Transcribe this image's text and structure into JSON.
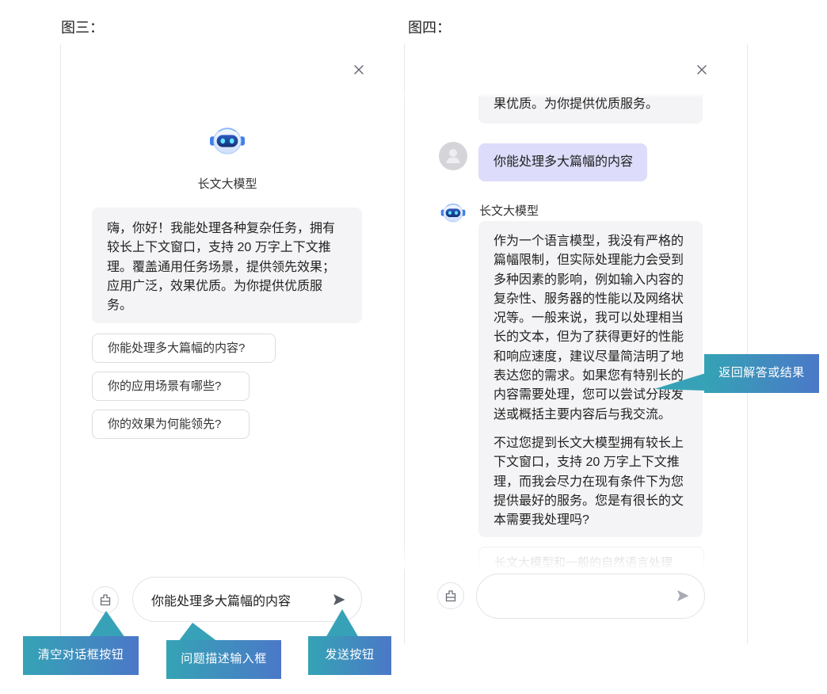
{
  "figure_labels": {
    "left": "图三：",
    "right": "图四："
  },
  "left_panel": {
    "bot_name": "长文大模型",
    "welcome_lines": [
      "嗨，你好！我能处理各种复杂任务，拥有",
      "较长上下文窗口，支持 20 万字上下文推",
      "理。覆盖通用任务场景，提供领先效果；",
      "应用广泛，效果优质。为你提供优质服",
      "务。"
    ],
    "suggestions": [
      "你能处理多大篇幅的内容?",
      "你的应用场景有哪些?",
      "你的效果为何能领先?"
    ],
    "input_value": "你能处理多大篇幅的内容",
    "icons": {
      "close": "close-icon",
      "avatar": "robot-avatar-icon",
      "clear": "clear-chat-icon",
      "send": "send-icon"
    }
  },
  "right_panel": {
    "previous_reply_tail": "果优质。为你提供优质服务。",
    "user_message": "你能处理多大篇幅的内容",
    "bot_name": "长文大模型",
    "reply_paragraphs": [
      [
        "作为一个语言模型，我没有严格的",
        "篇幅限制，但实际处理能力会受到",
        "多种因素的影响，例如输入内容的",
        "复杂性、服务器的性能以及网络状",
        "况等。一般来说，我可以处理相当",
        "长的文本，但为了获得更好的性能",
        "和响应速度，建议尽量简洁明了地",
        "表达您的需求。如果您有特别长的",
        "内容需要处理，您可以尝试分段发",
        "送或概括主要内容后与我交流。"
      ],
      [
        "不过您提到长文大模型拥有较长上",
        "下文窗口，支持 20 万字上下文推",
        "理，而我会尽力在现有条件下为您",
        "提供最好的服务。您是有很长的文",
        "本需要我处理吗?"
      ]
    ],
    "next_suggestion_partial": "长文大模型和一般的自然语言处理",
    "icons": {
      "close": "close-icon",
      "user_avatar": "user-avatar-icon",
      "bot_avatar": "robot-avatar-icon",
      "clear": "clear-chat-icon",
      "send": "send-icon"
    }
  },
  "callouts": {
    "clear_button": "清空对话框按钮",
    "input_box": "问题描述输入框",
    "send_button": "发送按钮",
    "reply_result": "返回解答或结果"
  },
  "colors": {
    "callout_start": "#35a3b5",
    "callout_end": "#4b78c8",
    "pointer": "#37a2b7",
    "bot_bubble": "#f4f4f6",
    "user_bubble": "#dddcfa",
    "send_active": "#585c66",
    "send_inactive": "#a9abb3"
  }
}
